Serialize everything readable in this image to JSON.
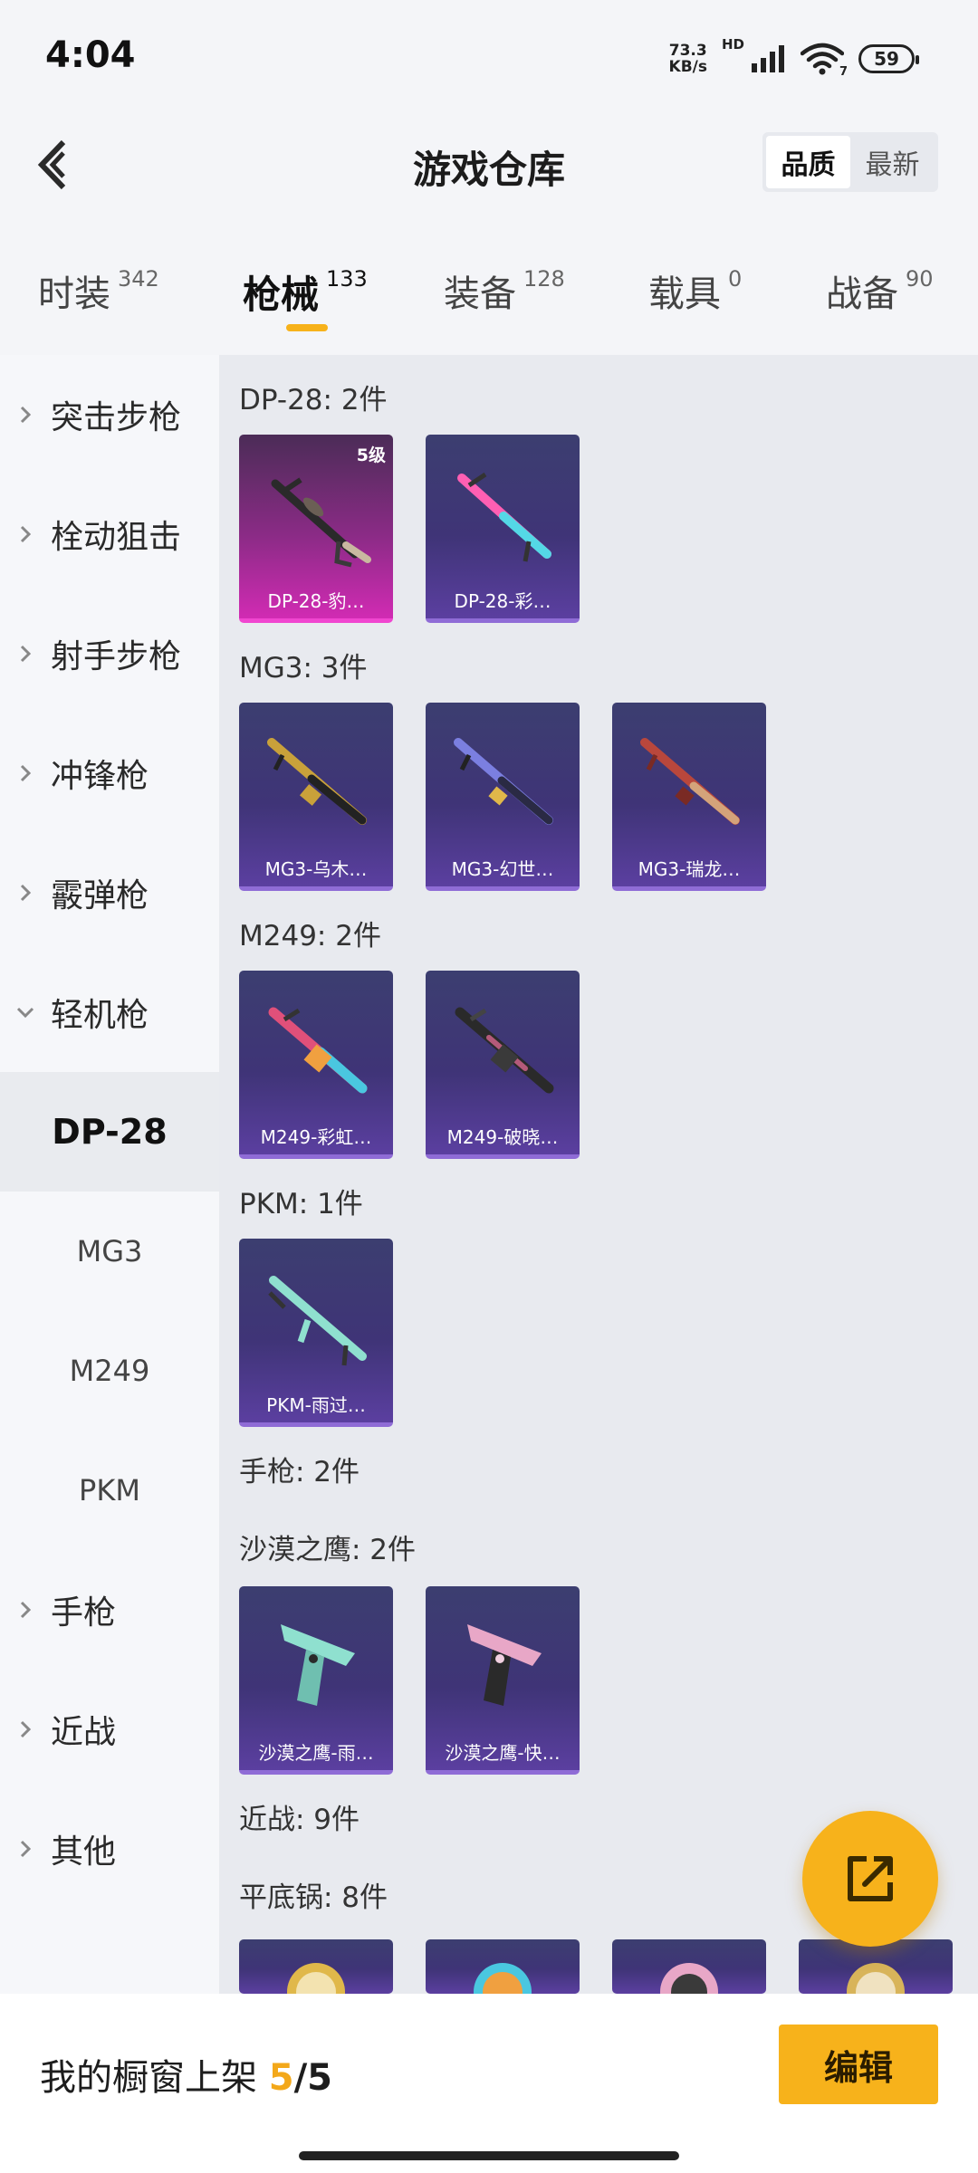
{
  "status_bar": {
    "time": "4:04",
    "net_speed_value": "73.3",
    "net_speed_unit": "KB/s",
    "hd_label": "HD",
    "wifi_sub": "7",
    "battery": "59"
  },
  "header": {
    "title": "游戏仓库",
    "sort_options": [
      "品质",
      "最新"
    ],
    "sort_selected": "品质"
  },
  "tabs": [
    {
      "label": "时装",
      "count": "342"
    },
    {
      "label": "枪械",
      "count": "133"
    },
    {
      "label": "装备",
      "count": "128"
    },
    {
      "label": "载具",
      "count": "0"
    },
    {
      "label": "战备",
      "count": "90"
    }
  ],
  "active_tab": "枪械",
  "sidebar": {
    "categories": [
      "突击步枪",
      "栓动狙击",
      "射手步枪",
      "冲锋枪",
      "霰弹枪",
      "轻机枪"
    ],
    "expanded": "轻机枪",
    "subitems": [
      "DP-28",
      "MG3",
      "M249",
      "PKM"
    ],
    "active_subitem": "DP-28",
    "more_categories": [
      "手枪",
      "近战",
      "其他"
    ]
  },
  "content": {
    "groups": [
      {
        "title": "DP-28: 2件",
        "items": [
          {
            "name": "DP-28-豹…",
            "level": "5级",
            "quality": "gold"
          },
          {
            "name": "DP-28-彩…",
            "quality": "purple"
          }
        ]
      },
      {
        "title": "MG3: 3件",
        "items": [
          {
            "name": "MG3-乌木…",
            "quality": "purple"
          },
          {
            "name": "MG3-幻世…",
            "quality": "purple"
          },
          {
            "name": "MG3-瑞龙…",
            "quality": "purple"
          }
        ]
      },
      {
        "title": "M249: 2件",
        "items": [
          {
            "name": "M249-彩虹…",
            "quality": "purple"
          },
          {
            "name": "M249-破晓…",
            "quality": "purple"
          }
        ]
      },
      {
        "title": "PKM: 1件",
        "items": [
          {
            "name": "PKM-雨过…",
            "quality": "purple"
          }
        ]
      },
      {
        "title": "手枪: 2件",
        "items": []
      },
      {
        "title": "沙漠之鹰: 2件",
        "items": [
          {
            "name": "沙漠之鹰-雨…",
            "quality": "purple"
          },
          {
            "name": "沙漠之鹰-快…",
            "quality": "purple"
          }
        ]
      },
      {
        "title": "近战: 9件",
        "items": []
      },
      {
        "title": "平底锅: 8件",
        "items": []
      }
    ]
  },
  "bottom_bar": {
    "label": "我的橱窗上架",
    "shown": "5",
    "separator": "/",
    "limit": "5",
    "edit_label": "编辑"
  },
  "colors": {
    "accent": "#f7b21b",
    "card_purple": "#3f3477",
    "card_gold": "#d12bb3"
  }
}
